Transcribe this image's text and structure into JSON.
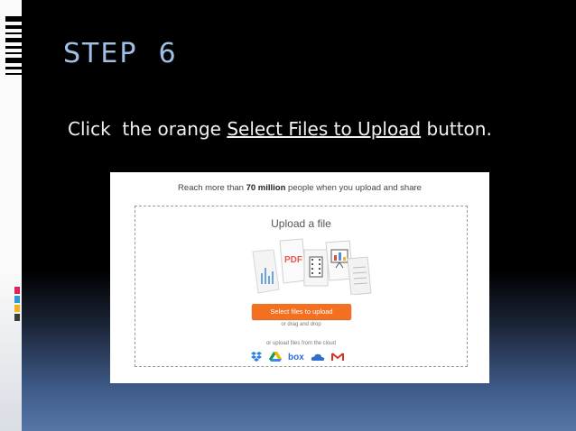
{
  "slide": {
    "title": "STEP  6",
    "instruction_prefix": "Click  the orange ",
    "instruction_link": "Select Files to Upload",
    "instruction_suffix": " button."
  },
  "upload_page": {
    "banner_prefix": "Reach more than ",
    "banner_bold": "70 million",
    "banner_suffix": " people when you upload and share",
    "heading": "Upload a file",
    "select_button_label": "Select files to upload",
    "drag_drop_text": "or drag and drop",
    "cloud_text": "or upload files from the cloud",
    "pdf_label": "PDF",
    "box_label": "box",
    "cloud_services": [
      "dropbox-icon",
      "google-drive-icon",
      "box-icon",
      "onedrive-icon",
      "gmail-icon"
    ]
  },
  "colors": {
    "title": "#9fc0e6",
    "instruction": "#f2f2f2",
    "button_orange": "#f37021",
    "slide_background": "#000000"
  }
}
